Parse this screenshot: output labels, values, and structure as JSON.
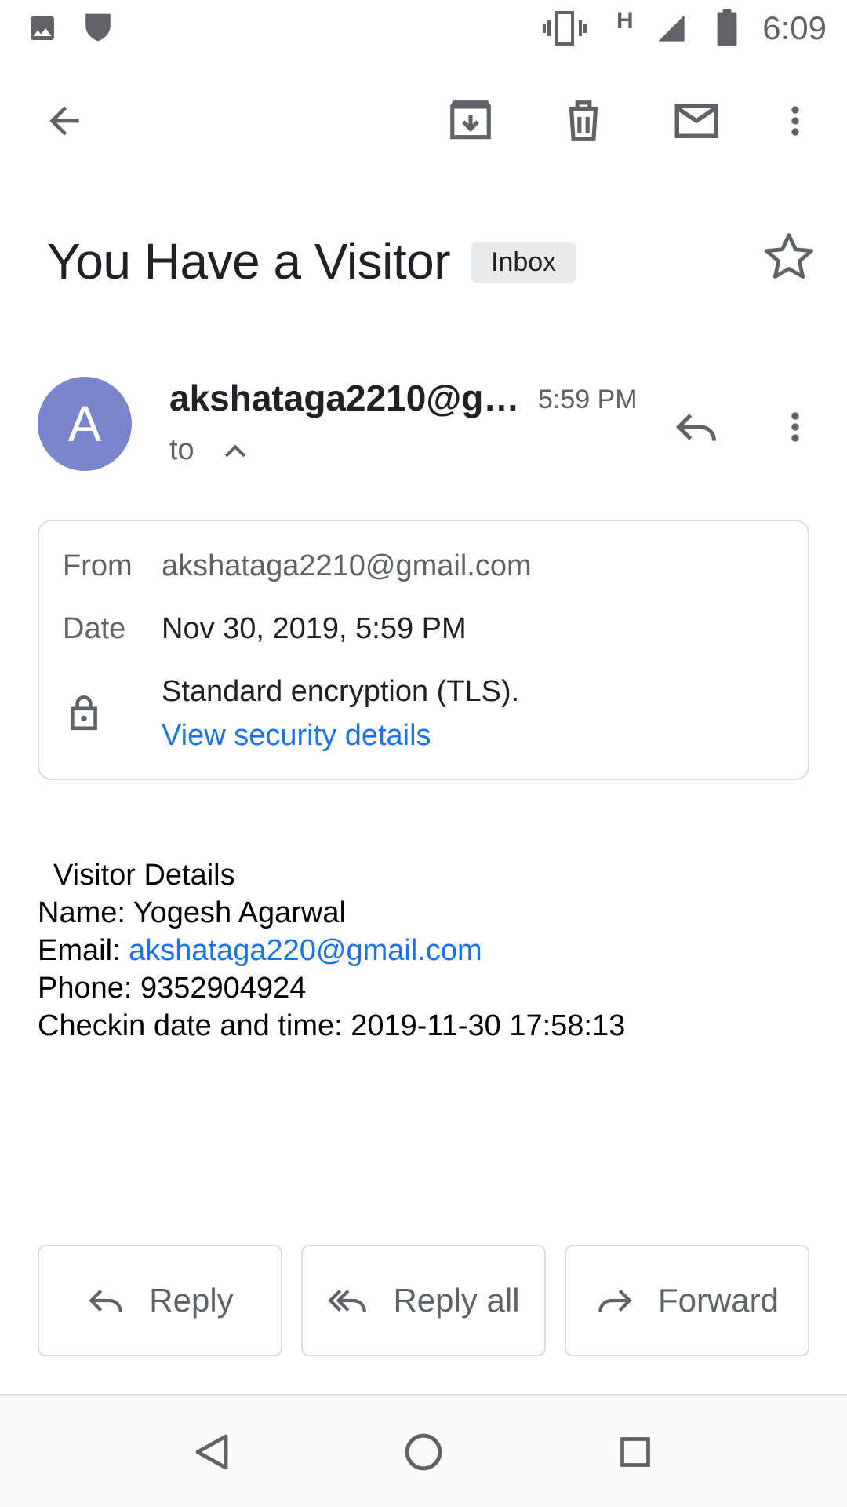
{
  "status_bar": {
    "time": "6:09",
    "network_label": "H",
    "icons": [
      "image-icon",
      "shield-icon",
      "vibrate-icon",
      "signal-icon",
      "battery-icon"
    ]
  },
  "toolbar": {
    "icons": [
      "back-arrow-icon",
      "archive-icon",
      "delete-icon",
      "mail-icon",
      "more-vert-icon"
    ]
  },
  "email": {
    "subject": "You Have a Visitor",
    "label_chip": "Inbox",
    "sender": "akshataga2210@gmail.com",
    "time": "5:59 PM",
    "to_label": "to",
    "avatar_letter": "A",
    "avatar_color": "#7986cb"
  },
  "details": {
    "from_label": "From",
    "from_value": "akshataga2210@gmail.com",
    "date_label": "Date",
    "date_value": "Nov 30, 2019, 5:59 PM",
    "encryption_text": "Standard encryption (TLS).",
    "security_link": "View security details"
  },
  "body": {
    "heading": "Visitor Details",
    "name_line": "Name: Yogesh Agarwal",
    "email_label": "Email: ",
    "email_link": "akshataga220@gmail.com",
    "phone_line": "Phone: 9352904924",
    "checkin_line": "Checkin date and time: 2019-11-30 17:58:13"
  },
  "actions": {
    "reply": "Reply",
    "reply_all": "Reply all",
    "forward": "Forward"
  },
  "nav": {
    "icons": [
      "nav-back-icon",
      "nav-home-icon",
      "nav-recents-icon"
    ]
  },
  "colors": {
    "accent": "#1a73e8",
    "avatar": "#7986cb",
    "icon": "#5f6368",
    "chip_bg": "#e8eaed",
    "border": "#dadce0"
  }
}
